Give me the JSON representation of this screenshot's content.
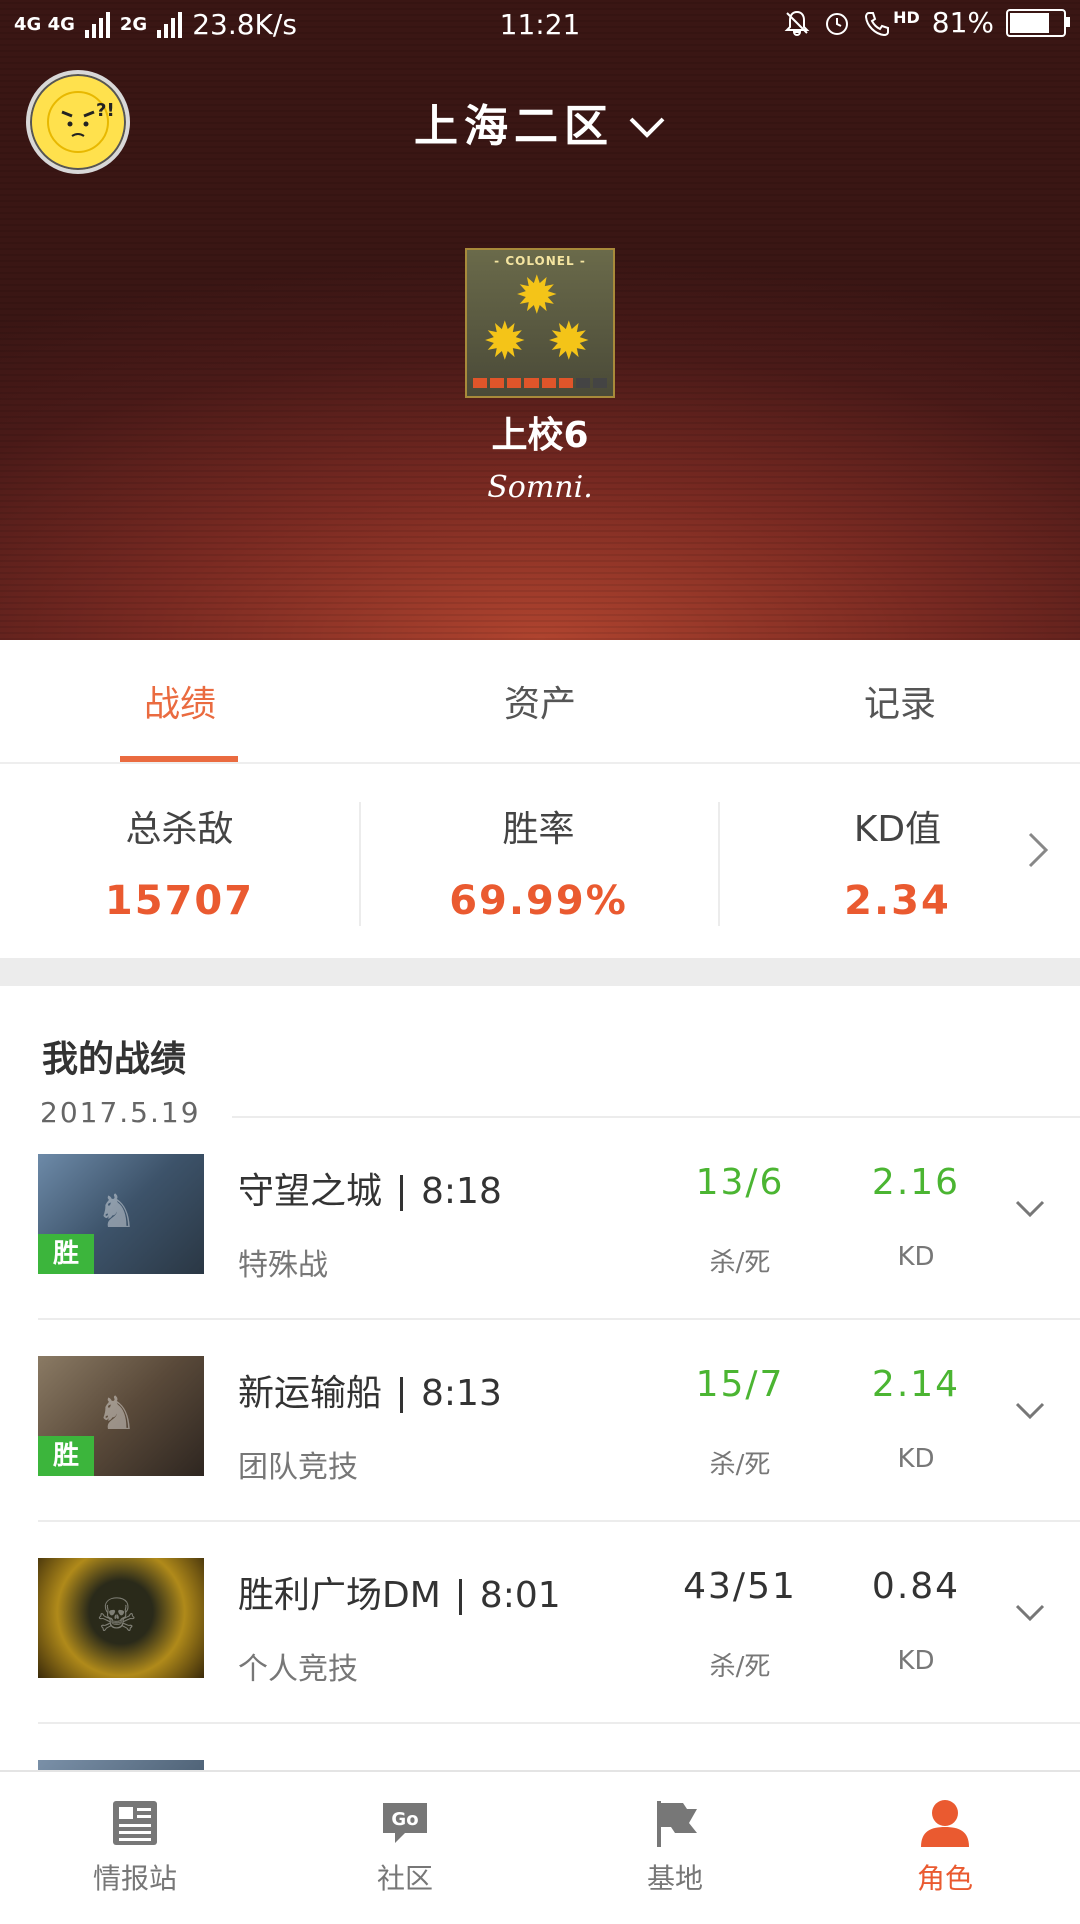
{
  "status_bar": {
    "network": "4G 4G",
    "network2": "2G",
    "speed": "23.8K/s",
    "time": "11:21",
    "hd_label": "HD",
    "battery": "81%",
    "battery_level": 0.81
  },
  "header": {
    "region": "上海二区",
    "emblem_caption": "- COLONEL -",
    "emblem_progress": 0.7,
    "rank": "上校6",
    "nickname": "Somni."
  },
  "tabs": [
    {
      "label": "战绩",
      "active": true
    },
    {
      "label": "资产",
      "active": false
    },
    {
      "label": "记录",
      "active": false
    }
  ],
  "stats": [
    {
      "label": "总杀敌",
      "value": "15707"
    },
    {
      "label": "胜率",
      "value": "69.99%"
    },
    {
      "label": "KD值",
      "value": "2.34"
    }
  ],
  "records_section": {
    "title": "我的战绩",
    "date": "2017.5.19",
    "rows": [
      {
        "map": "守望之城",
        "time": "8:18",
        "mode": "特殊战",
        "kills_deaths": "13/6",
        "kd_label": "杀/死",
        "kd": "2.16",
        "kd_name": "KD",
        "badge": "胜",
        "highlight": true
      },
      {
        "map": "新运输船",
        "time": "8:13",
        "mode": "团队竞技",
        "kills_deaths": "15/7",
        "kd_label": "杀/死",
        "kd": "2.14",
        "kd_name": "KD",
        "badge": "胜",
        "highlight": true
      },
      {
        "map": "胜利广场DM",
        "time": "8:01",
        "mode": "个人竞技",
        "kills_deaths": "43/51",
        "kd_label": "杀/死",
        "kd": "0.84",
        "kd_name": "KD",
        "badge": "",
        "highlight": false
      }
    ]
  },
  "bottom_nav": [
    {
      "label": "情报站",
      "icon": "newspaper-icon",
      "active": false
    },
    {
      "label": "社区",
      "icon": "chat-bubble-icon",
      "active": false
    },
    {
      "label": "基地",
      "icon": "flag-icon",
      "active": false
    },
    {
      "label": "角色",
      "icon": "person-icon",
      "active": true
    }
  ],
  "colors": {
    "accent": "#ea5a30",
    "win_green": "#4bb532",
    "header_dark": "#3a1614"
  }
}
